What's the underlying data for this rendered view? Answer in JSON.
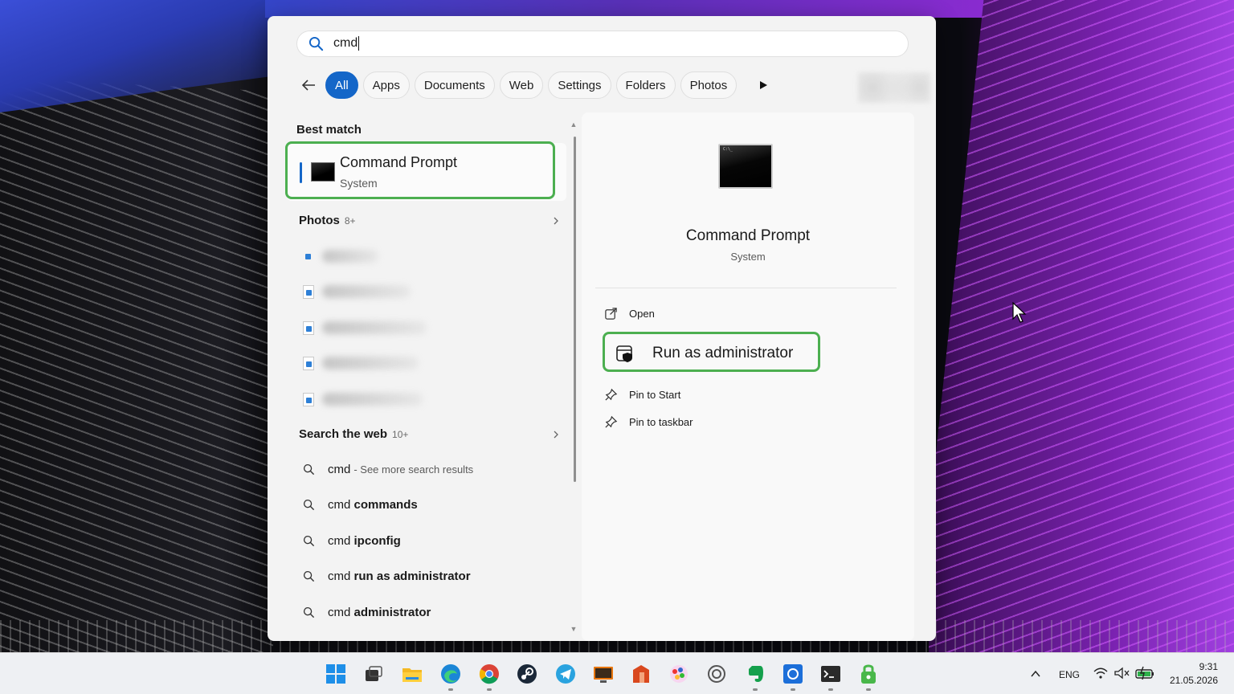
{
  "search": {
    "query": "cmd"
  },
  "filters": {
    "items": [
      "All",
      "Apps",
      "Documents",
      "Web",
      "Settings",
      "Folders",
      "Photos"
    ],
    "active": "All"
  },
  "best_match": {
    "section_label": "Best match",
    "title": "Command Prompt",
    "subtitle": "System"
  },
  "photos": {
    "section_label": "Photos",
    "count": "8+"
  },
  "web": {
    "section_label": "Search the web",
    "count": "10+",
    "results": [
      {
        "prefix": "cmd",
        "bold": "",
        "hint": "- See more search results"
      },
      {
        "prefix": "cmd ",
        "bold": "commands",
        "hint": ""
      },
      {
        "prefix": "cmd ",
        "bold": "ipconfig",
        "hint": ""
      },
      {
        "prefix": "cmd ",
        "bold": "run as administrator",
        "hint": ""
      },
      {
        "prefix": "cmd ",
        "bold": "administrator",
        "hint": ""
      }
    ]
  },
  "details": {
    "title": "Command Prompt",
    "subtitle": "System",
    "actions": [
      "Open",
      "Run as administrator",
      "Pin to Start",
      "Pin to taskbar"
    ]
  },
  "taskbar": {
    "apps": [
      "start-icon",
      "task-view-icon",
      "file-explorer-icon",
      "edge-icon",
      "chrome-icon",
      "steam-icon",
      "telegram-icon",
      "remote-desktop-icon",
      "office-icon",
      "paint-icon",
      "chatgpt-icon",
      "evernote-icon",
      "app-icon",
      "terminal-icon",
      "vpn-icon"
    ],
    "language": "ENG",
    "time": "9:31",
    "date": "21.05.2026"
  },
  "colors": {
    "accent": "#1466c8",
    "highlight": "#4caf50"
  }
}
